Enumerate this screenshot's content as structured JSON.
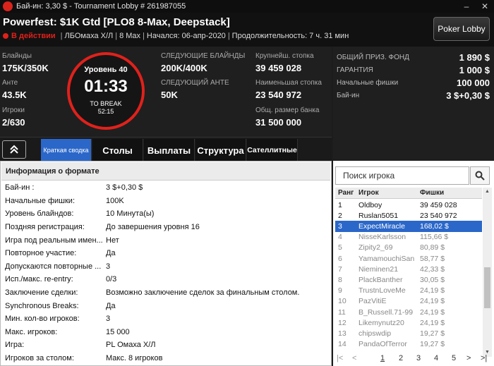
{
  "window": {
    "title": "Бай-ин: 3,30 $ - Tournament Lobby # 261987055",
    "minimize": "–",
    "close": "✕"
  },
  "header": {
    "tournament_name": "Powerfest: $1K Gtd [PLO8 8-Max, Deepstack]",
    "status": "В действии",
    "game": "ЛБОмаха Х/Л",
    "max": "8 Max",
    "started": "Начался: 06-апр-2020",
    "duration": "Продолжительность: 7 ч. 31 мин",
    "lobby_button": "Poker Lobby",
    "status_color": "#e0211b"
  },
  "stats": {
    "blinds_label": "Блайнды",
    "blinds_value": "175K/350K",
    "ante_label": "Анте",
    "ante_value": "43.5K",
    "players_label": "Игроки",
    "players_value": "2/630",
    "timer": {
      "level": "Уровень 40",
      "time": "01:33",
      "to_break": "TO BREAK",
      "break_time": "52:15"
    },
    "next_blinds_label": "СЛЕДУЮЩИЕ БЛАЙНДЫ",
    "next_blinds_value": "200K/400K",
    "next_ante_label": "СЛЕДУЮЩИЙ АНТЕ",
    "next_ante_value": "50K",
    "largest_stack_label": "Крупнейш. стопка",
    "largest_stack_value": "39 459 028",
    "smallest_stack_label": "Наименьшая стопка",
    "smallest_stack_value": "23 540 972",
    "total_bank_label": "Общ. размер банка",
    "total_bank_value": "31 500 000"
  },
  "summary": {
    "prize_pool_label": "ОБЩИЙ ПРИЗ. ФОНД",
    "prize_pool_value": "1 890 $",
    "guarantee_label": "ГАРАНТИЯ",
    "guarantee_value": "1 000 $",
    "starting_chips_label": "Начальные фишки",
    "starting_chips_value": "100 000",
    "buyin_label": "Бай-ин",
    "buyin_value": "3 $+0,30 $"
  },
  "tabs": {
    "summary": "Краткая сводка",
    "tables": "Столы",
    "payouts": "Выплаты",
    "structure": "Структура",
    "satellites": "Сателлитные"
  },
  "info": {
    "title": "Информация о формате",
    "rows": [
      {
        "k": "Бай-ин :",
        "v": "3 $+0,30 $"
      },
      {
        "k": "Начальные фишки:",
        "v": "100K"
      },
      {
        "k": "Уровень блайндов:",
        "v": "10 Минута(ы)"
      },
      {
        "k": "Поздняя регистрация:",
        "v": "До завершения уровня 16"
      },
      {
        "k": "Игра под реальным имен...",
        "v": "Нет"
      },
      {
        "k": "Повторное участие:",
        "v": "Да"
      },
      {
        "k": "Допускаются повторные ...",
        "v": "3"
      },
      {
        "k": "Исп./макс. re-entry:",
        "v": "0/3"
      },
      {
        "k": "Заключение сделки:",
        "v": "Возможно заключение сделок за финальным столом."
      },
      {
        "k": "Synchronous Breaks:",
        "v": "Да"
      },
      {
        "k": "Мин. кол-во игроков:",
        "v": "3"
      },
      {
        "k": "Макс. игроков:",
        "v": "15 000"
      },
      {
        "k": "Игра:",
        "v": "PL Омаха Х/Л"
      },
      {
        "k": "Игроков за столом:",
        "v": "Макс. 8 игроков"
      }
    ]
  },
  "players": {
    "search_placeholder": "Поиск игрока",
    "col_rank": "Ранг",
    "col_player": "Игрок",
    "col_chips": "Фишки",
    "rows": [
      {
        "rank": "1",
        "name": "Oldboy",
        "chips": "39 459 028",
        "active": true
      },
      {
        "rank": "2",
        "name": "Ruslan5051",
        "chips": "23 540 972",
        "active": true
      },
      {
        "rank": "3",
        "name": "ExpectMiracle",
        "chips": "168,02 $",
        "active": false
      },
      {
        "rank": "4",
        "name": "NisseKarlsson",
        "chips": "115,66 $",
        "active": false
      },
      {
        "rank": "5",
        "name": "Zipity2_69",
        "chips": "80,89 $",
        "active": false
      },
      {
        "rank": "6",
        "name": "YamamouchiSan",
        "chips": "58,77 $",
        "active": false
      },
      {
        "rank": "7",
        "name": "Nieminen21",
        "chips": "42,33 $",
        "active": false
      },
      {
        "rank": "8",
        "name": "PlackBanther",
        "chips": "30,05 $",
        "active": false
      },
      {
        "rank": "9",
        "name": "TrustnLoveMe",
        "chips": "24,19 $",
        "active": false
      },
      {
        "rank": "10",
        "name": "PazVitiE",
        "chips": "24,19 $",
        "active": false
      },
      {
        "rank": "11",
        "name": "B_Russell.71-99",
        "chips": "24,19 $",
        "active": false
      },
      {
        "rank": "12",
        "name": "Likemynutz20",
        "chips": "24,19 $",
        "active": false
      },
      {
        "rank": "13",
        "name": "chipswdip",
        "chips": "19,27 $",
        "active": false
      },
      {
        "rank": "14",
        "name": "PandaOfTerror",
        "chips": "19,27 $",
        "active": false
      }
    ],
    "selected_index": 2,
    "pager": {
      "first": "|<",
      "prev": "<",
      "pages": [
        "1",
        "2",
        "3",
        "4",
        "5"
      ],
      "current": "1",
      "next": ">",
      "last": ">|"
    }
  }
}
